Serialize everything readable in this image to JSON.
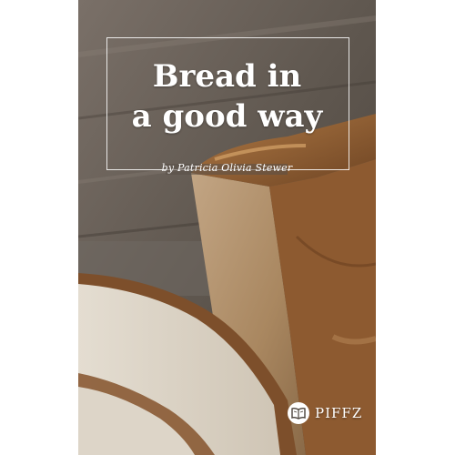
{
  "book": {
    "title_line1": "Bread in",
    "title_line2": "a good way",
    "author": "by Patricia Olivia Stewer",
    "publisher": "PIFFZ"
  },
  "icons": {
    "publisher_logo": "open-book-icon"
  },
  "colors": {
    "text": "#ffffff",
    "background": "#ffffff",
    "crust": "#8a5a34",
    "crumb": "#d9d1c4"
  }
}
